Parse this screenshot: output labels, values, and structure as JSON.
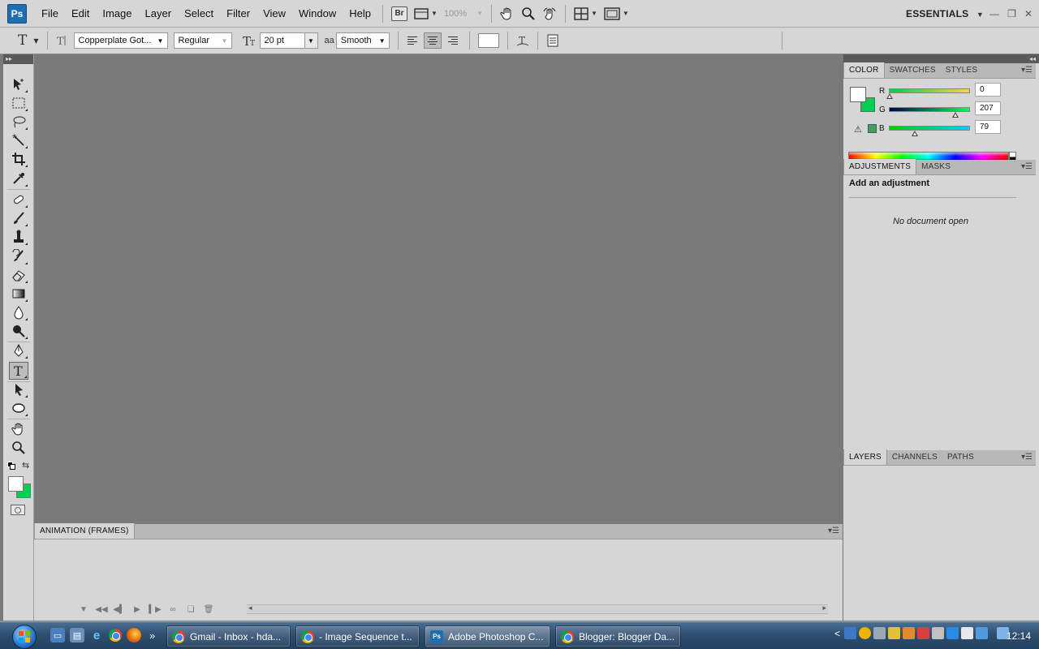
{
  "app": {
    "logo": "Ps"
  },
  "menu": [
    "File",
    "Edit",
    "Image",
    "Layer",
    "Select",
    "Filter",
    "View",
    "Window",
    "Help"
  ],
  "menubar": {
    "bridge_label": "Br",
    "zoom_level": "100%",
    "workspace": "ESSENTIALS"
  },
  "options_bar": {
    "tool_icon": "T",
    "font_family": "Copperplate Got...",
    "font_style": "Regular",
    "font_size": "20 pt",
    "anti_alias_glyph": "aa",
    "anti_alias": "Smooth",
    "active_alignment": "center"
  },
  "toolbox": {
    "active_tool": "type-tool",
    "tools": [
      "move-tool",
      "marquee-tool",
      "lasso-tool",
      "quick-selection-tool",
      "crop-tool",
      "eyedropper-tool",
      "healing-brush-tool",
      "brush-tool",
      "clone-stamp-tool",
      "history-brush-tool",
      "eraser-tool",
      "gradient-tool",
      "blur-tool",
      "dodge-tool",
      "pen-tool",
      "type-tool",
      "path-selection-tool",
      "shape-tool",
      "hand-tool",
      "zoom-tool"
    ],
    "foreground_color": "#ffffff",
    "background_color": "#00cf4f"
  },
  "animation_panel": {
    "title": "ANIMATION (FRAMES)"
  },
  "color_panel": {
    "tabs": [
      "COLOR",
      "SWATCHES",
      "STYLES"
    ],
    "foreground_color": "#ffffff",
    "background_color": "#00cf4f",
    "channels": [
      {
        "label": "R",
        "value": "0",
        "level": 0.0
      },
      {
        "label": "G",
        "value": "207",
        "level": 0.81
      },
      {
        "label": "B",
        "value": "79",
        "level": 0.31
      }
    ]
  },
  "adjustments_panel": {
    "tabs": [
      "ADJUSTMENTS",
      "MASKS"
    ],
    "heading": "Add an adjustment",
    "message": "No document open"
  },
  "layers_panel": {
    "tabs": [
      "LAYERS",
      "CHANNELS",
      "PATHS"
    ]
  },
  "taskbar": {
    "buttons": [
      {
        "label": "Gmail - Inbox - hda...",
        "icon": "chrome-icon",
        "active": false
      },
      {
        "label": "- Image Sequence t...",
        "icon": "chrome-icon",
        "active": false
      },
      {
        "label": "Adobe Photoshop C...",
        "icon": "photoshop-icon",
        "active": true
      },
      {
        "label": "Blogger: Blogger Da...",
        "icon": "chrome-icon",
        "active": false
      }
    ],
    "more_glyph": "»",
    "tray_expand_glyph": "<",
    "clock": "12:14"
  }
}
